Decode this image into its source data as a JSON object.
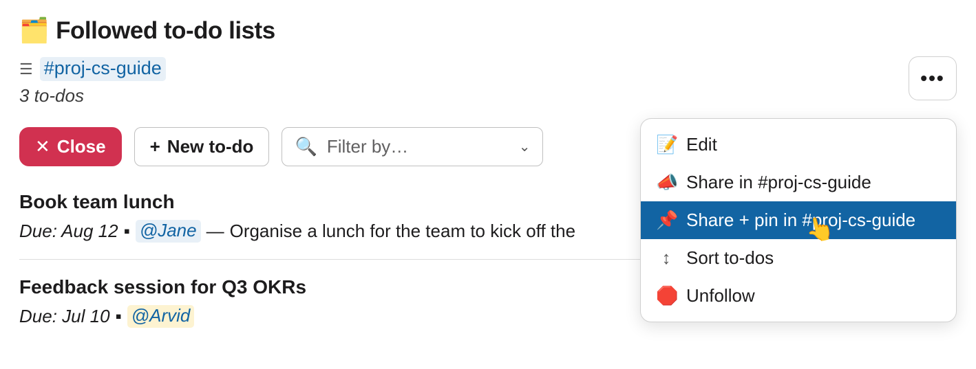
{
  "header": {
    "icon": "🗂️",
    "title": "Followed to-do lists"
  },
  "channel": {
    "name": "#proj-cs-guide",
    "count_text": "3 to-dos"
  },
  "toolbar": {
    "close_label": "Close",
    "new_label": "New to-do",
    "filter_placeholder": "Filter by…"
  },
  "overflow_menu": {
    "items": [
      {
        "icon": "📝",
        "label": "Edit",
        "highlight": false
      },
      {
        "icon": "📣",
        "label": "Share in #proj-cs-guide",
        "highlight": false
      },
      {
        "icon": "📌",
        "label": "Share + pin in #proj-cs-guide",
        "highlight": true
      },
      {
        "icon": "↕",
        "label": "Sort to-dos",
        "highlight": false
      },
      {
        "icon": "🛑",
        "label": "Unfollow",
        "highlight": false
      }
    ]
  },
  "todos": [
    {
      "title": "Book team lunch",
      "due": "Due: Aug 12",
      "mention": "@Jane",
      "mention_style": "blue",
      "desc": "Organise a lunch for the team to kick off the"
    },
    {
      "title": "Feedback session for Q3 OKRs",
      "due": "Due: Jul 10",
      "mention": "@Arvid",
      "mention_style": "yellow",
      "desc": ""
    }
  ]
}
